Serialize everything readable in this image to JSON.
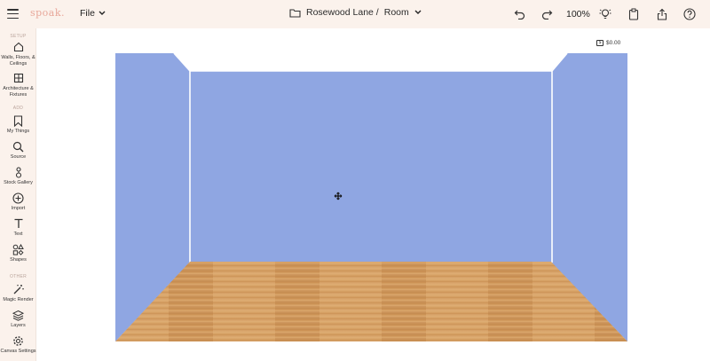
{
  "header": {
    "logo": "spoak.",
    "file_label": "File",
    "breadcrumb_project": "Rosewood Lane /",
    "breadcrumb_room": "Room",
    "zoom": "100%"
  },
  "sidebar": {
    "sections": [
      "SETUP",
      "ADD",
      "OTHER"
    ],
    "items": [
      {
        "label": "Walls, Floors, & Ceilings",
        "icon": "house-icon"
      },
      {
        "label": "Architecture & Fixtures",
        "icon": "window-icon"
      },
      {
        "label": "My Things",
        "icon": "bookmark-icon"
      },
      {
        "label": "Source",
        "icon": "search-icon"
      },
      {
        "label": "Stock Gallery",
        "icon": "stock-gallery-icon"
      },
      {
        "label": "Import",
        "icon": "plus-circle-icon"
      },
      {
        "label": "Text",
        "icon": "text-icon"
      },
      {
        "label": "Shapes",
        "icon": "shapes-icon"
      },
      {
        "label": "Magic Render",
        "icon": "magic-wand-icon"
      },
      {
        "label": "Layers",
        "icon": "layers-icon"
      },
      {
        "label": "Canvas Settings",
        "icon": "gear-icon"
      }
    ]
  },
  "canvas": {
    "price": "$0.00",
    "wall_color": "#8fa6e2",
    "floor_color": "#d9a66a"
  }
}
